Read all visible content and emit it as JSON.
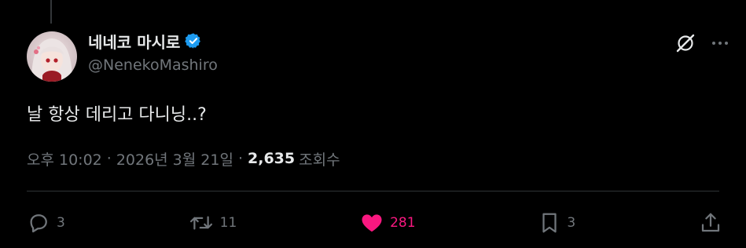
{
  "author": {
    "display_name": "네네코 마시로",
    "handle": "@NenekoMashiro",
    "verified": true,
    "verified_color": "#1d9bf0"
  },
  "tweet": {
    "text": "날 항상 데리고 다니닝..?",
    "time": "오후 10:02",
    "date": "2026년 3월 21일",
    "views_count": "2,635",
    "views_label": "조회수",
    "separator": "·"
  },
  "icons": {
    "top": [
      "grok-icon",
      "more-icon"
    ],
    "actions": [
      "reply-icon",
      "retweet-icon",
      "heart-icon",
      "bookmark-icon",
      "share-icon"
    ]
  },
  "actions": {
    "reply_count": "3",
    "retweet_count": "11",
    "like_count": "281",
    "bookmark_count": "3",
    "like_color": "#f91880"
  },
  "colors": {
    "background": "#000000",
    "text": "#e7e9ea",
    "muted": "#71767b",
    "divider": "#2f3336"
  }
}
